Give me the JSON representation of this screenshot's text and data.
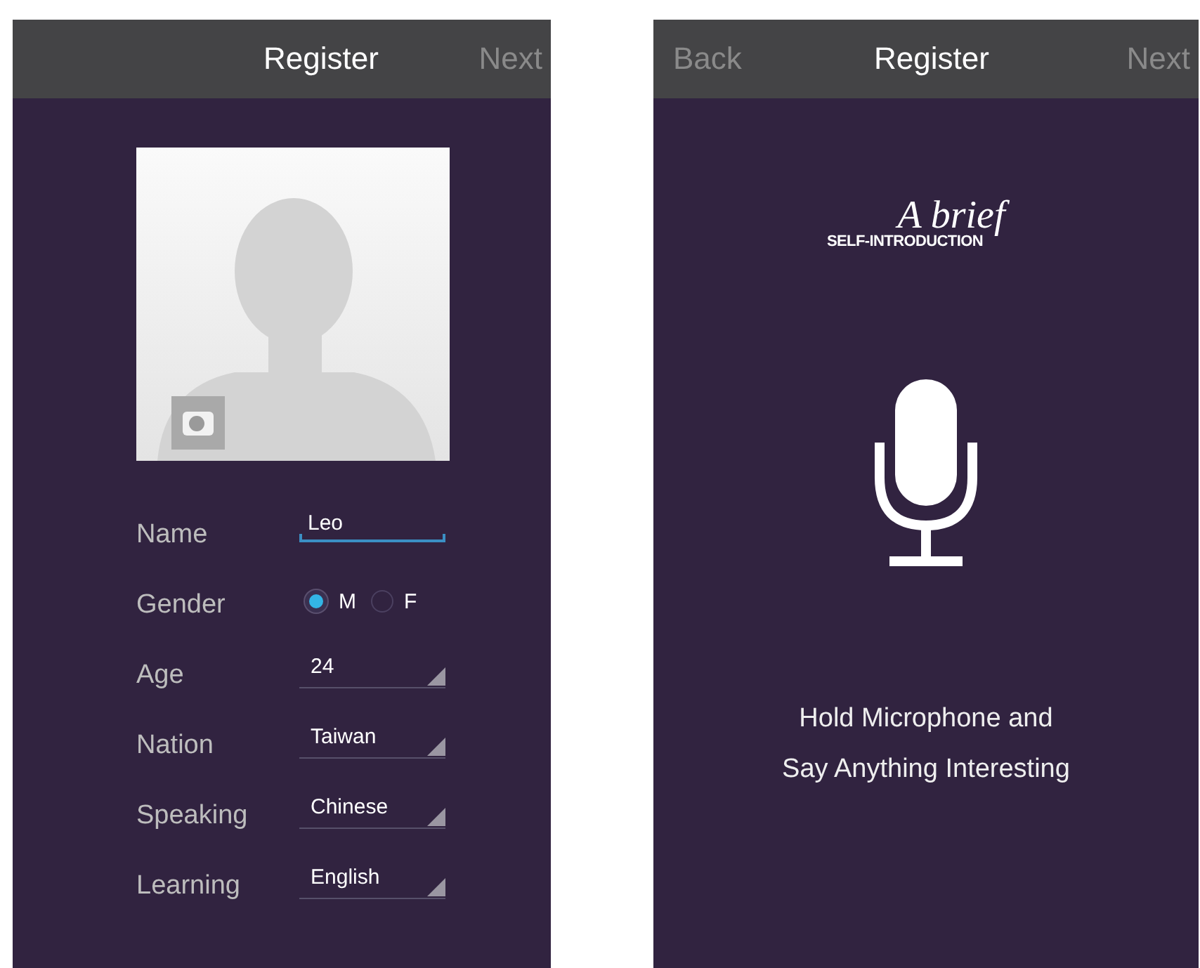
{
  "screens": [
    {
      "header": {
        "title": "Register",
        "next": "Next"
      },
      "fields": [
        {
          "kind": "text",
          "label": "Name",
          "value": "Leo"
        },
        {
          "kind": "radio",
          "label": "Gender",
          "options": [
            {
              "label": "M",
              "selected": true
            },
            {
              "label": "F",
              "selected": false
            }
          ]
        },
        {
          "kind": "select",
          "label": "Age",
          "value": "24"
        },
        {
          "kind": "select",
          "label": "Nation",
          "value": "Taiwan"
        },
        {
          "kind": "select",
          "label": "Speaking",
          "value": "Chinese"
        },
        {
          "kind": "select",
          "label": "Learning",
          "value": "English"
        }
      ]
    },
    {
      "header": {
        "back": "Back",
        "title": "Register",
        "next": "Next"
      },
      "logo": {
        "script": "A brief",
        "caption": "SELF-INTRODUCTION"
      },
      "instruction_lines": [
        "Hold Microphone and",
        "Say Anything Interesting"
      ]
    }
  ]
}
